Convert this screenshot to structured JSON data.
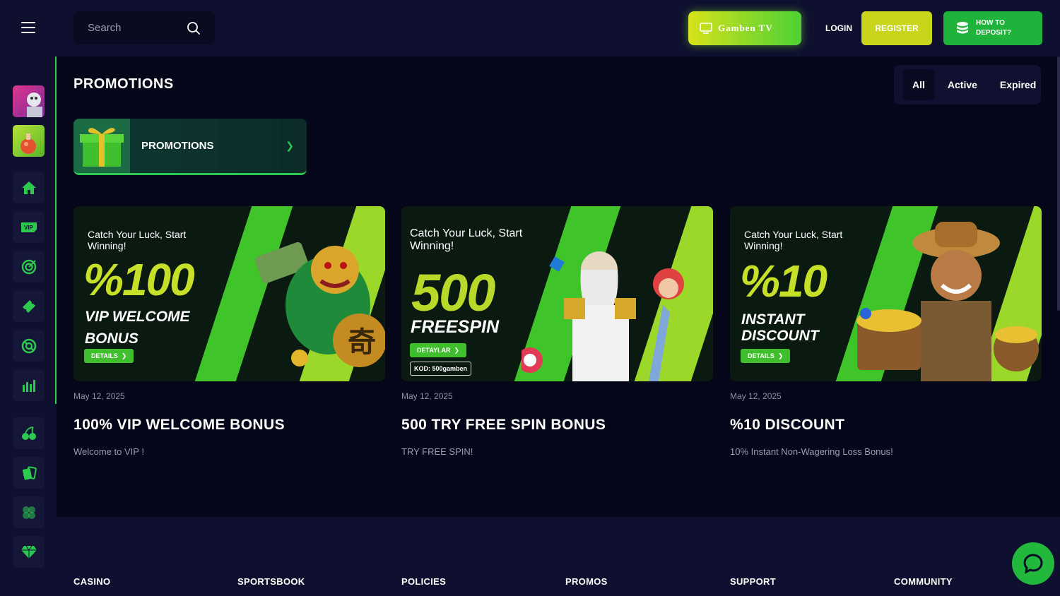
{
  "header": {
    "search_placeholder": "Search",
    "tv_label": "Gamben TV",
    "login_label": "LOGIN",
    "register_label": "REGISTER",
    "deposit_label": "HOW TO DEPOSIT?"
  },
  "sidebar": {
    "items": [
      {
        "icon": "home-icon"
      },
      {
        "icon": "vip-icon",
        "label": "VIP"
      },
      {
        "icon": "target-icon"
      },
      {
        "icon": "ticket-icon"
      },
      {
        "icon": "lifebuoy-icon"
      },
      {
        "icon": "chart-icon"
      },
      {
        "icon": "cherry-icon"
      },
      {
        "icon": "cards-icon"
      },
      {
        "icon": "clover-icon"
      },
      {
        "icon": "diamond-icon"
      }
    ]
  },
  "main": {
    "title": "PROMOTIONS",
    "filter_tabs": [
      {
        "label": "All",
        "active": true
      },
      {
        "label": "Active",
        "active": false
      },
      {
        "label": "Expired",
        "active": false
      }
    ],
    "category": {
      "label": "PROMOTIONS"
    },
    "cards": [
      {
        "banner": {
          "tagline": "Catch Your Luck, Start Winning!",
          "big": "%100",
          "sub1": "VIP WELCOME",
          "sub2": "BONUS",
          "button": "DETAILS"
        },
        "date": "May 12, 2025",
        "title": "100% VIP WELCOME BONUS",
        "desc": "Welcome to VIP !"
      },
      {
        "banner": {
          "tagline": "Catch Your Luck, Start Winning!",
          "big": "500",
          "sub1": "FREESPIN",
          "button": "DETAYLAR",
          "code": "KOD: 500gamben"
        },
        "date": "May 12, 2025",
        "title": "500 TRY FREE SPIN BONUS",
        "desc": "TRY FREE SPIN!"
      },
      {
        "banner": {
          "tagline": "Catch Your Luck, Start Winning!",
          "big": "%10",
          "sub1": "INSTANT",
          "sub2": "DISCOUNT",
          "button": "DETAILS"
        },
        "date": "May 12, 2025",
        "title": "%10 DISCOUNT",
        "desc": "10% Instant Non-Wagering Loss Bonus!"
      }
    ]
  },
  "footer": {
    "columns": [
      "CASINO",
      "SPORTSBOOK",
      "POLICIES",
      "PROMOS",
      "SUPPORT",
      "COMMUNITY"
    ]
  },
  "colors": {
    "accent_green": "#2bc94e",
    "accent_yellow": "#c8d51a",
    "background": "#05061a",
    "panel": "#0f1030"
  }
}
